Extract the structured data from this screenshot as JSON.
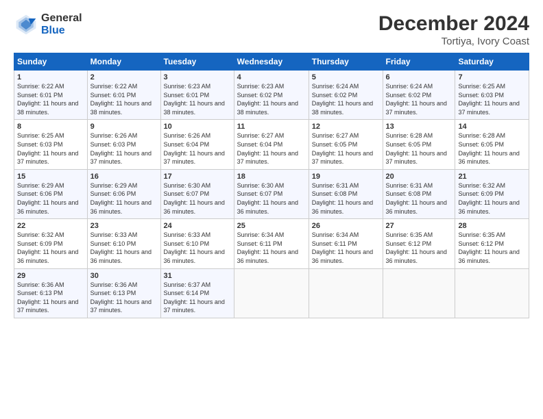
{
  "header": {
    "logo_line1": "General",
    "logo_line2": "Blue",
    "title": "December 2024",
    "subtitle": "Tortiya, Ivory Coast"
  },
  "weekdays": [
    "Sunday",
    "Monday",
    "Tuesday",
    "Wednesday",
    "Thursday",
    "Friday",
    "Saturday"
  ],
  "weeks": [
    [
      {
        "day": "1",
        "sunrise": "6:22 AM",
        "sunset": "6:01 PM",
        "daylight": "11 hours and 38 minutes."
      },
      {
        "day": "2",
        "sunrise": "6:22 AM",
        "sunset": "6:01 PM",
        "daylight": "11 hours and 38 minutes."
      },
      {
        "day": "3",
        "sunrise": "6:23 AM",
        "sunset": "6:01 PM",
        "daylight": "11 hours and 38 minutes."
      },
      {
        "day": "4",
        "sunrise": "6:23 AM",
        "sunset": "6:02 PM",
        "daylight": "11 hours and 38 minutes."
      },
      {
        "day": "5",
        "sunrise": "6:24 AM",
        "sunset": "6:02 PM",
        "daylight": "11 hours and 38 minutes."
      },
      {
        "day": "6",
        "sunrise": "6:24 AM",
        "sunset": "6:02 PM",
        "daylight": "11 hours and 37 minutes."
      },
      {
        "day": "7",
        "sunrise": "6:25 AM",
        "sunset": "6:03 PM",
        "daylight": "11 hours and 37 minutes."
      }
    ],
    [
      {
        "day": "8",
        "sunrise": "6:25 AM",
        "sunset": "6:03 PM",
        "daylight": "11 hours and 37 minutes."
      },
      {
        "day": "9",
        "sunrise": "6:26 AM",
        "sunset": "6:03 PM",
        "daylight": "11 hours and 37 minutes."
      },
      {
        "day": "10",
        "sunrise": "6:26 AM",
        "sunset": "6:04 PM",
        "daylight": "11 hours and 37 minutes."
      },
      {
        "day": "11",
        "sunrise": "6:27 AM",
        "sunset": "6:04 PM",
        "daylight": "11 hours and 37 minutes."
      },
      {
        "day": "12",
        "sunrise": "6:27 AM",
        "sunset": "6:05 PM",
        "daylight": "11 hours and 37 minutes."
      },
      {
        "day": "13",
        "sunrise": "6:28 AM",
        "sunset": "6:05 PM",
        "daylight": "11 hours and 37 minutes."
      },
      {
        "day": "14",
        "sunrise": "6:28 AM",
        "sunset": "6:05 PM",
        "daylight": "11 hours and 36 minutes."
      }
    ],
    [
      {
        "day": "15",
        "sunrise": "6:29 AM",
        "sunset": "6:06 PM",
        "daylight": "11 hours and 36 minutes."
      },
      {
        "day": "16",
        "sunrise": "6:29 AM",
        "sunset": "6:06 PM",
        "daylight": "11 hours and 36 minutes."
      },
      {
        "day": "17",
        "sunrise": "6:30 AM",
        "sunset": "6:07 PM",
        "daylight": "11 hours and 36 minutes."
      },
      {
        "day": "18",
        "sunrise": "6:30 AM",
        "sunset": "6:07 PM",
        "daylight": "11 hours and 36 minutes."
      },
      {
        "day": "19",
        "sunrise": "6:31 AM",
        "sunset": "6:08 PM",
        "daylight": "11 hours and 36 minutes."
      },
      {
        "day": "20",
        "sunrise": "6:31 AM",
        "sunset": "6:08 PM",
        "daylight": "11 hours and 36 minutes."
      },
      {
        "day": "21",
        "sunrise": "6:32 AM",
        "sunset": "6:09 PM",
        "daylight": "11 hours and 36 minutes."
      }
    ],
    [
      {
        "day": "22",
        "sunrise": "6:32 AM",
        "sunset": "6:09 PM",
        "daylight": "11 hours and 36 minutes."
      },
      {
        "day": "23",
        "sunrise": "6:33 AM",
        "sunset": "6:10 PM",
        "daylight": "11 hours and 36 minutes."
      },
      {
        "day": "24",
        "sunrise": "6:33 AM",
        "sunset": "6:10 PM",
        "daylight": "11 hours and 36 minutes."
      },
      {
        "day": "25",
        "sunrise": "6:34 AM",
        "sunset": "6:11 PM",
        "daylight": "11 hours and 36 minutes."
      },
      {
        "day": "26",
        "sunrise": "6:34 AM",
        "sunset": "6:11 PM",
        "daylight": "11 hours and 36 minutes."
      },
      {
        "day": "27",
        "sunrise": "6:35 AM",
        "sunset": "6:12 PM",
        "daylight": "11 hours and 36 minutes."
      },
      {
        "day": "28",
        "sunrise": "6:35 AM",
        "sunset": "6:12 PM",
        "daylight": "11 hours and 36 minutes."
      }
    ],
    [
      {
        "day": "29",
        "sunrise": "6:36 AM",
        "sunset": "6:13 PM",
        "daylight": "11 hours and 37 minutes."
      },
      {
        "day": "30",
        "sunrise": "6:36 AM",
        "sunset": "6:13 PM",
        "daylight": "11 hours and 37 minutes."
      },
      {
        "day": "31",
        "sunrise": "6:37 AM",
        "sunset": "6:14 PM",
        "daylight": "11 hours and 37 minutes."
      },
      null,
      null,
      null,
      null
    ]
  ]
}
